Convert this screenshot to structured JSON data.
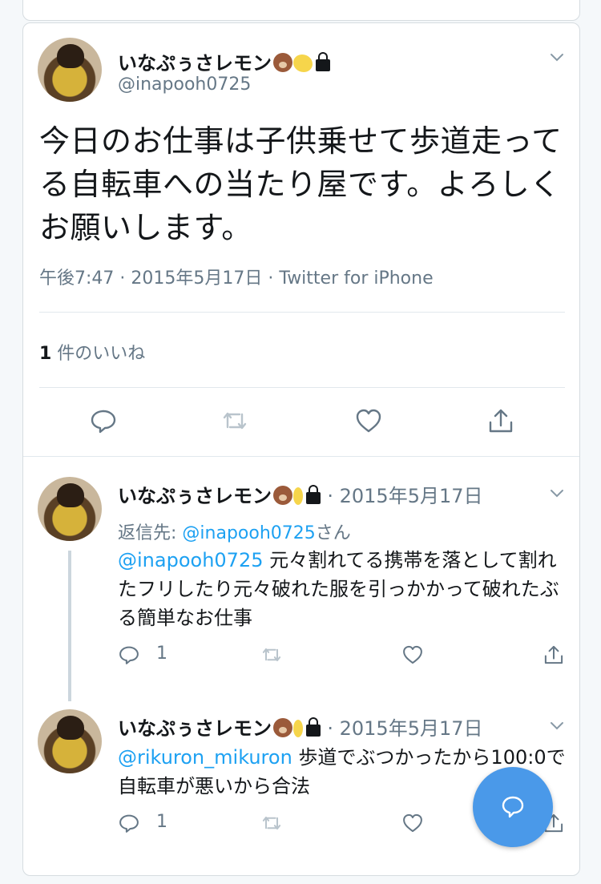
{
  "main_tweet": {
    "display_name": "いなぷぅさレモン",
    "handle": "@inapooh0725",
    "text": "今日のお仕事は子供乗せて歩道走ってる自転車への当たり屋です。よろしくお願いします。",
    "time": "午後7:47",
    "date": "2015年5月17日",
    "source": "Twitter for iPhone",
    "likes_count": "1",
    "likes_label": " 件のいいね"
  },
  "replies": [
    {
      "display_name": "いなぷぅさレモン",
      "date": "· 2015年5月17日",
      "reply_to_label": "返信先: ",
      "reply_to_handle": "@inapooh0725",
      "reply_to_suffix": "さん",
      "mention": "@inapooh0725",
      "text": " 元々割れてる携帯を落として割れたフリしたり元々破れた服を引っかかって破れたぶる簡単なお仕事",
      "reply_count": "1"
    },
    {
      "display_name": "いなぷぅさレモン",
      "date": "· 2015年5月17日",
      "mention": "@rikuron_mikuron",
      "text": " 歩道でぶつかったから100:0で自転車が悪いから合法",
      "reply_count": "1"
    }
  ],
  "colors": {
    "accent": "#1da1f2",
    "secondary_text": "#657786",
    "fab": "#4a99e9"
  },
  "icons": [
    "chevron-down-icon",
    "reply-icon",
    "retweet-icon",
    "like-icon",
    "share-icon",
    "compose-icon",
    "lock-icon",
    "bear-emoji",
    "lemon-emoji"
  ]
}
